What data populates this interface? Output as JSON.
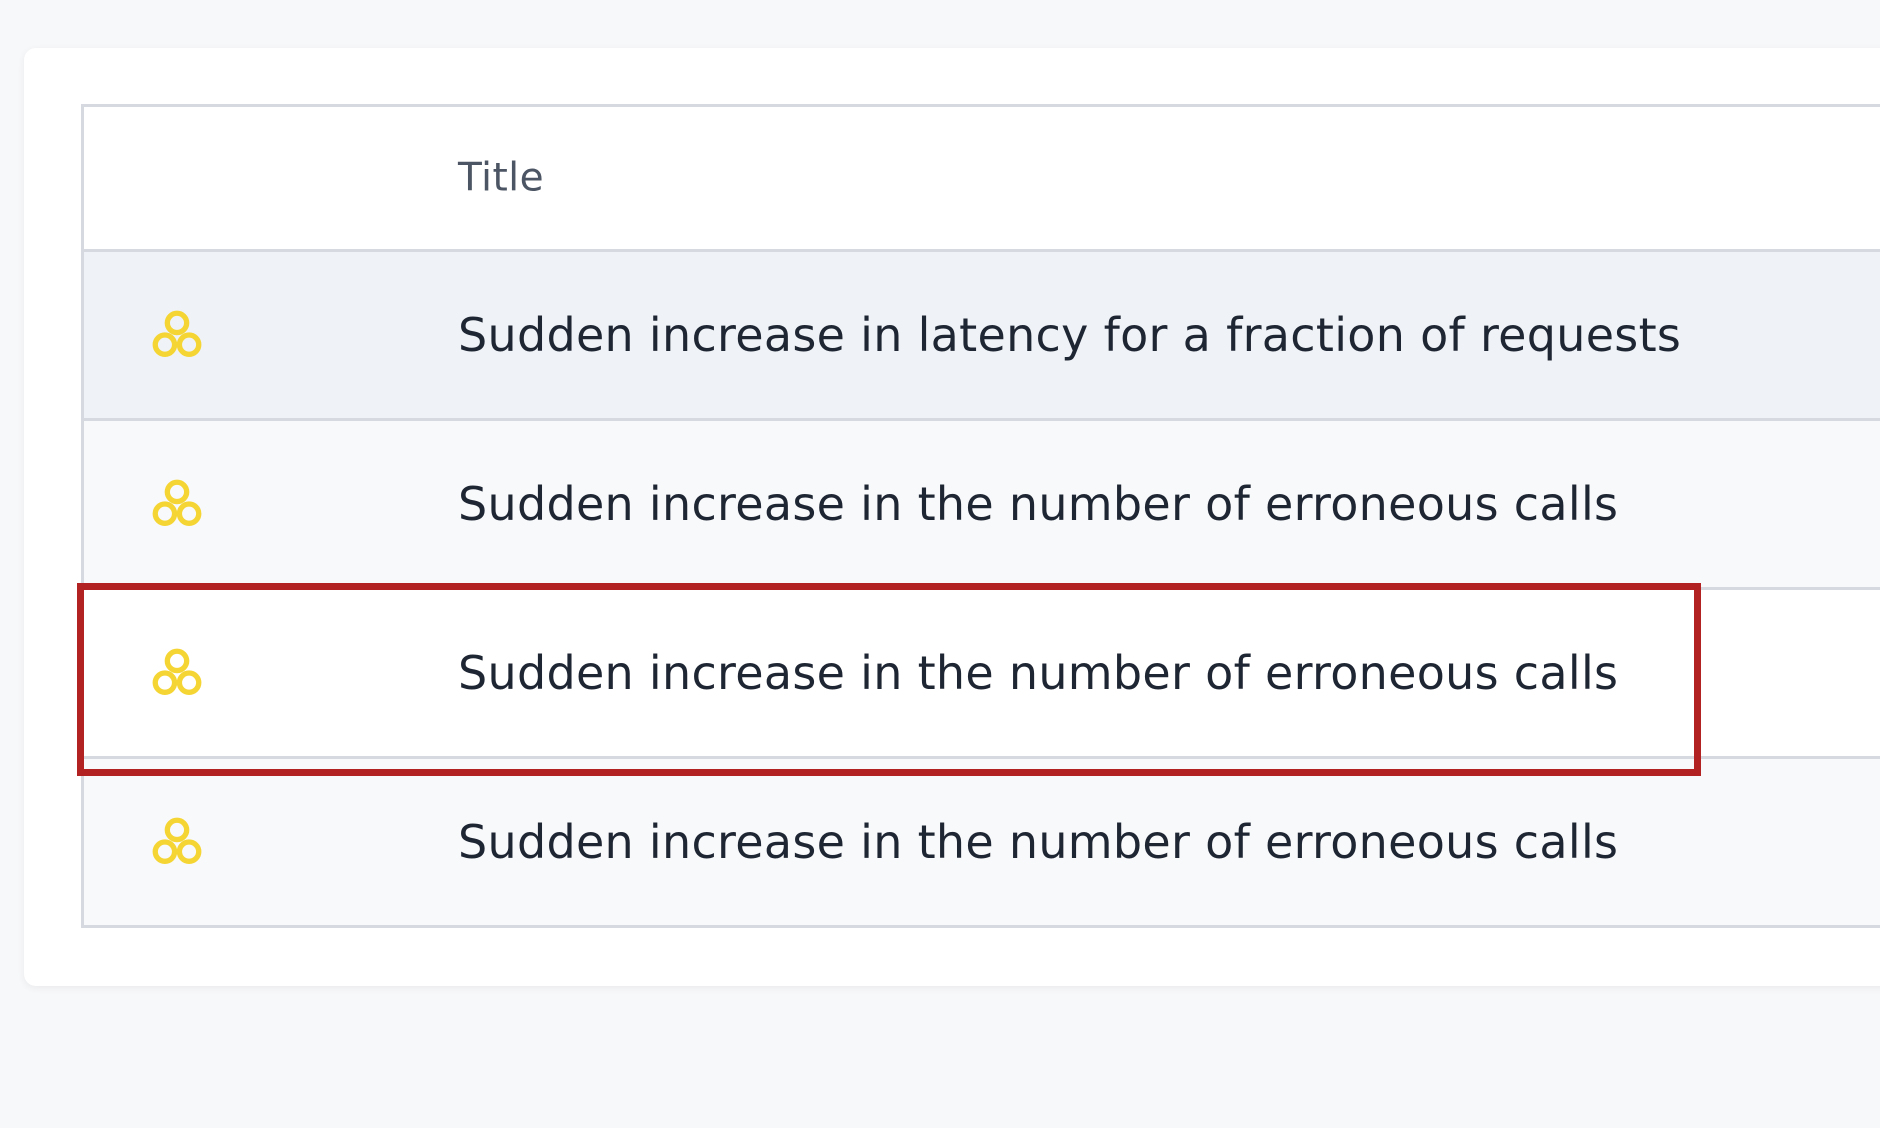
{
  "table": {
    "columns": {
      "icon": "",
      "title": "Title"
    },
    "rows": [
      {
        "icon": "cluster-icon",
        "title": "Sudden increase in latency for a fraction of requests",
        "state": "hovered"
      },
      {
        "icon": "cluster-icon",
        "title": "Sudden increase in the number of erroneous calls",
        "state": "alt"
      },
      {
        "icon": "cluster-icon",
        "title": "Sudden increase in the number of erroneous calls",
        "state": "selected"
      },
      {
        "icon": "cluster-icon",
        "title": "Sudden increase in the number of erroneous calls",
        "state": "alt"
      }
    ]
  },
  "colors": {
    "icon": "#f5d533",
    "highlight": "#b22222",
    "background": "#f7f8fa",
    "hover_row": "#eff3f7"
  }
}
